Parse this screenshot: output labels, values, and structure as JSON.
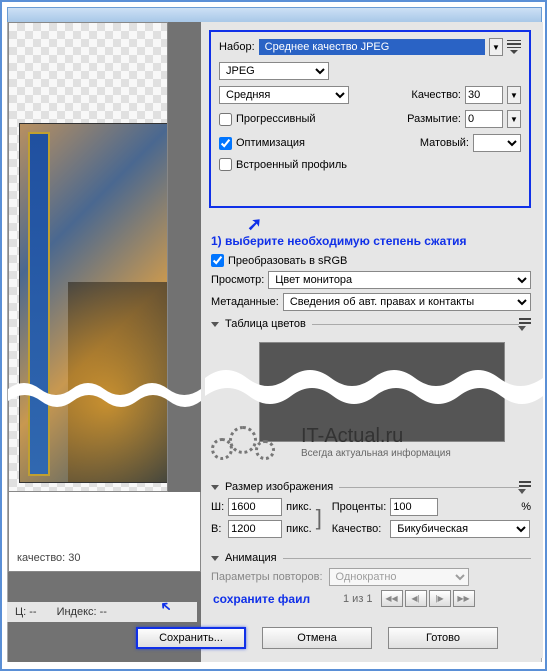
{
  "preset": {
    "label": "Набор:",
    "value": "Среднее качество JPEG"
  },
  "format": {
    "value": "JPEG"
  },
  "qualityName": {
    "value": "Средняя",
    "label": "Качество:",
    "num": "30"
  },
  "blur": {
    "label": "Размытие:",
    "value": "0"
  },
  "matte": {
    "label": "Матовый:",
    "value": ""
  },
  "chk": {
    "progressive": "Прогрессивный",
    "optimize": "Оптимизация",
    "embed": "Встроенный профиль",
    "srgb": "Преобразовать в sRGB"
  },
  "annot": {
    "step1": "1) выберите необходимую степень сжатия",
    "step2": "сохраните фаил"
  },
  "view": {
    "label": "Просмотр:",
    "value": "Цвет монитора"
  },
  "meta": {
    "label": "Метаданные:",
    "value": "Сведения об авт. правах и контакты"
  },
  "ct": {
    "label": "Таблица цветов"
  },
  "wm": {
    "title": "IT-Actual.ru",
    "sub": "Всегда актуальная информация"
  },
  "size": {
    "header": "Размер изображения",
    "w_lbl": "Ш:",
    "w": "1600",
    "px": "пикс.",
    "h_lbl": "В:",
    "h": "1200",
    "pct_lbl": "Проценты:",
    "pct": "100",
    "pct_unit": "%",
    "q_lbl": "Качество:",
    "q": "Бикубическая"
  },
  "anim": {
    "header": "Анимация",
    "loop_lbl": "Параметры повторов:",
    "loop": "Однократно",
    "frame": "1 из 1"
  },
  "preview": {
    "quality": "качество: 30"
  },
  "status": {
    "c": "Ц: --",
    "idx": "Индекс: --"
  },
  "buttons": {
    "save": "Сохранить...",
    "cancel": "Отмена",
    "done": "Готово"
  }
}
